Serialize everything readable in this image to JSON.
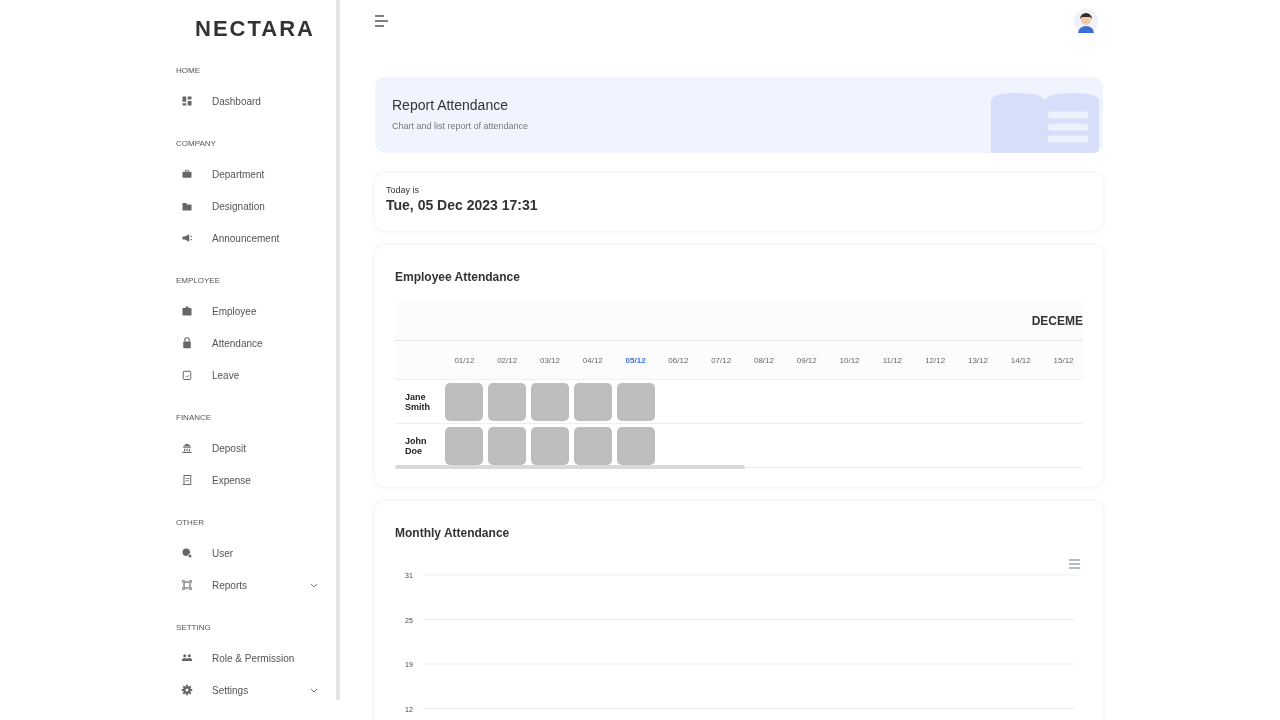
{
  "sidebar": {
    "logo": "NECTARA",
    "sections": [
      {
        "title": "HOME",
        "items": [
          {
            "label": "Dashboard",
            "kind": "link"
          }
        ]
      },
      {
        "title": "COMPANY",
        "items": [
          {
            "label": "Department",
            "kind": "link"
          },
          {
            "label": "Designation",
            "kind": "link"
          },
          {
            "label": "Announcement",
            "kind": "link"
          }
        ]
      },
      {
        "title": "EMPLOYEE",
        "items": [
          {
            "label": "Employee",
            "kind": "link"
          },
          {
            "label": "Attendance",
            "kind": "link"
          },
          {
            "label": "Leave",
            "kind": "link"
          }
        ]
      },
      {
        "title": "FINANCE",
        "items": [
          {
            "label": "Deposit",
            "kind": "link"
          },
          {
            "label": "Expense",
            "kind": "link"
          }
        ]
      },
      {
        "title": "OTHER",
        "items": [
          {
            "label": "User",
            "kind": "link"
          },
          {
            "label": "Reports",
            "kind": "group",
            "expanded": false
          }
        ]
      },
      {
        "title": "SETTING",
        "items": [
          {
            "label": "Role & Permission",
            "kind": "link"
          },
          {
            "label": "Settings",
            "kind": "group",
            "expanded": false
          }
        ]
      }
    ]
  },
  "banner": {
    "title": "Report Attendance",
    "subtitle": "Chart and list report of attendance"
  },
  "today": {
    "label": "Today is",
    "value": "Tue, 05 Dec 2023 17:31"
  },
  "employee_attendance": {
    "title": "Employee Attendance",
    "month": "DECEME",
    "dates": [
      {
        "label": "01/12",
        "selected": false
      },
      {
        "label": "02/12",
        "selected": false
      },
      {
        "label": "03/12",
        "selected": false
      },
      {
        "label": "04/12",
        "selected": false
      },
      {
        "label": "05/12",
        "selected": true
      },
      {
        "label": "06/12",
        "selected": false
      },
      {
        "label": "07/12",
        "selected": false
      },
      {
        "label": "08/12",
        "selected": false
      },
      {
        "label": "09/12",
        "selected": false
      },
      {
        "label": "10/12",
        "selected": false
      },
      {
        "label": "11/12",
        "selected": false
      },
      {
        "label": "12/12",
        "selected": false
      },
      {
        "label": "13/12",
        "selected": false
      },
      {
        "label": "14/12",
        "selected": false
      },
      {
        "label": "15/12",
        "selected": false
      }
    ],
    "rows": [
      {
        "name": "Jane Smith",
        "cells": [
          {
            "kind": "grey"
          },
          {
            "kind": "grey"
          },
          {
            "kind": "grey"
          },
          {
            "kind": "grey"
          },
          {
            "kind": "grey"
          },
          {
            "kind": "empty"
          },
          {
            "kind": "empty"
          },
          {
            "kind": "empty"
          },
          {
            "kind": "empty"
          },
          {
            "kind": "empty"
          },
          {
            "kind": "empty"
          },
          {
            "kind": "empty"
          },
          {
            "kind": "empty"
          },
          {
            "kind": "empty"
          },
          {
            "kind": "empty"
          }
        ]
      },
      {
        "name": "John Doe",
        "cells": [
          {
            "kind": "grey"
          },
          {
            "kind": "grey"
          },
          {
            "kind": "grey"
          },
          {
            "kind": "grey"
          },
          {
            "kind": "grey"
          },
          {
            "kind": "empty"
          },
          {
            "kind": "empty"
          },
          {
            "kind": "empty"
          },
          {
            "kind": "empty"
          },
          {
            "kind": "empty"
          },
          {
            "kind": "empty"
          },
          {
            "kind": "empty"
          },
          {
            "kind": "empty"
          },
          {
            "kind": "empty"
          },
          {
            "kind": "empty"
          }
        ]
      }
    ]
  },
  "monthly_attendance": {
    "title": "Monthly Attendance",
    "y_axis_labels": [
      "31",
      "25",
      "19",
      "12"
    ]
  }
}
